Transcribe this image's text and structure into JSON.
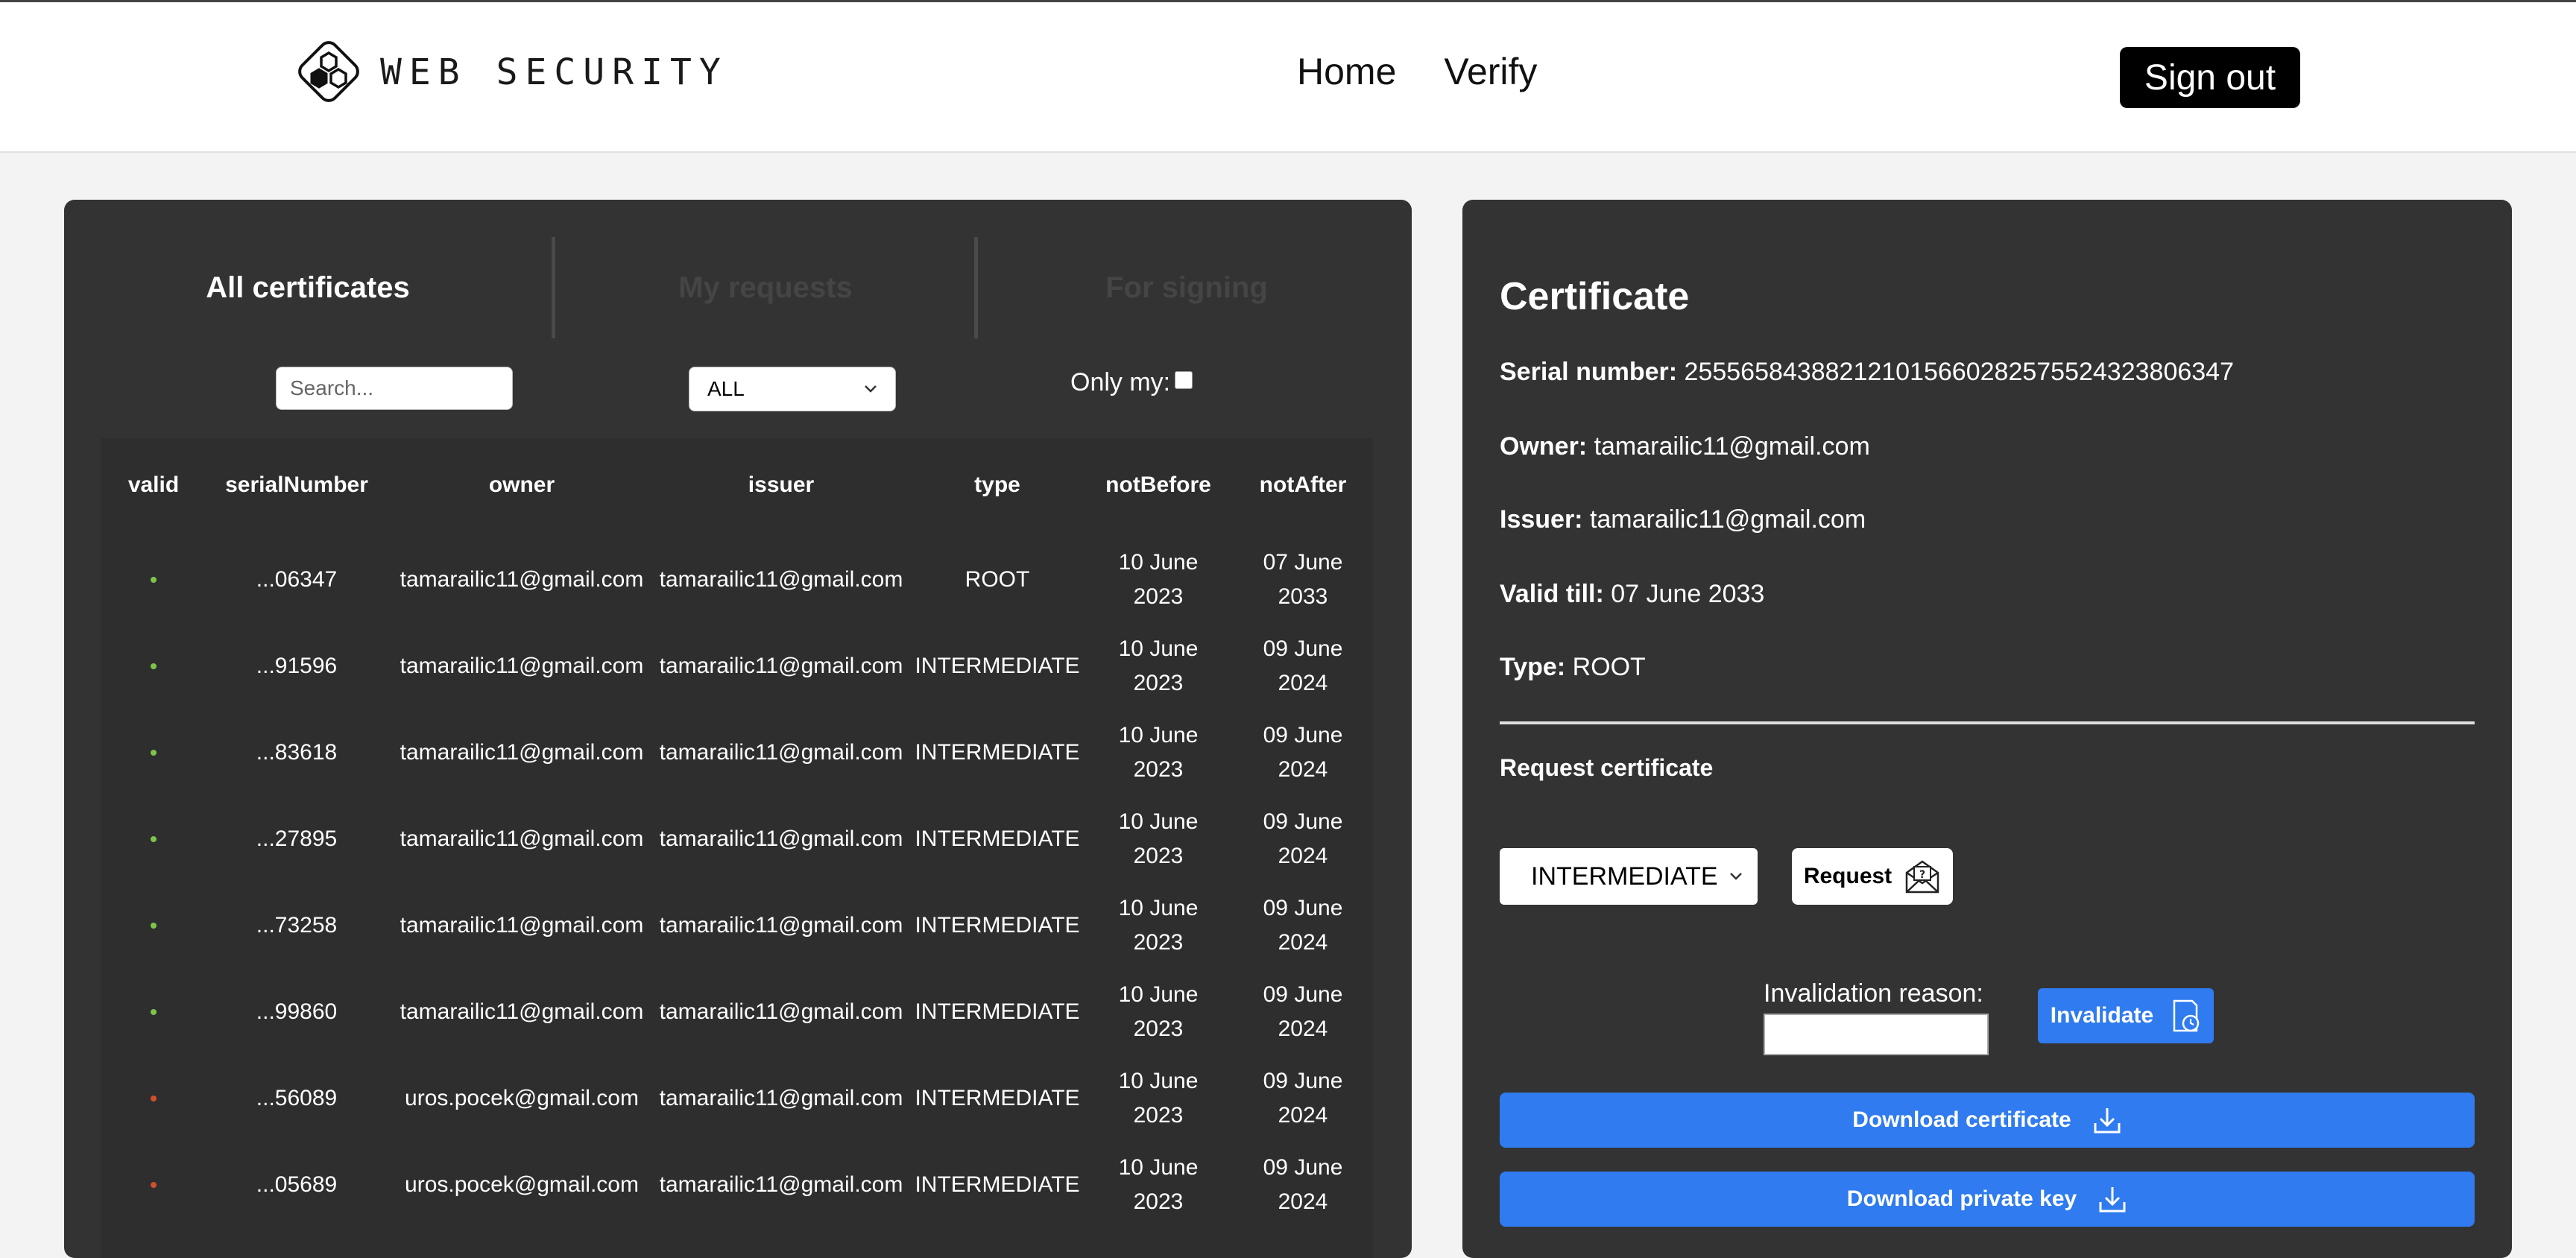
{
  "header": {
    "logo_text": "WEB SECURITY",
    "nav": [
      "Home",
      "Verify"
    ],
    "signout_label": "Sign out"
  },
  "tabs": [
    "All certificates",
    "My requests",
    "For signing"
  ],
  "filters": {
    "search_placeholder": "Search...",
    "type_filter_value": "ALL",
    "only_my_label": "Only my:"
  },
  "table": {
    "columns": [
      "valid",
      "serialNumber",
      "owner",
      "issuer",
      "type",
      "notBefore",
      "notAfter"
    ],
    "rows": [
      {
        "valid": true,
        "serial": "...06347",
        "owner": "tamarailic11@gmail.com",
        "issuer": "tamarailic11@gmail.com",
        "type": "ROOT",
        "notBefore": [
          "10 June",
          "2023"
        ],
        "notAfter": [
          "07 June",
          "2033"
        ]
      },
      {
        "valid": true,
        "serial": "...91596",
        "owner": "tamarailic11@gmail.com",
        "issuer": "tamarailic11@gmail.com",
        "type": "INTERMEDIATE",
        "notBefore": [
          "10 June",
          "2023"
        ],
        "notAfter": [
          "09 June",
          "2024"
        ]
      },
      {
        "valid": true,
        "serial": "...83618",
        "owner": "tamarailic11@gmail.com",
        "issuer": "tamarailic11@gmail.com",
        "type": "INTERMEDIATE",
        "notBefore": [
          "10 June",
          "2023"
        ],
        "notAfter": [
          "09 June",
          "2024"
        ]
      },
      {
        "valid": true,
        "serial": "...27895",
        "owner": "tamarailic11@gmail.com",
        "issuer": "tamarailic11@gmail.com",
        "type": "INTERMEDIATE",
        "notBefore": [
          "10 June",
          "2023"
        ],
        "notAfter": [
          "09 June",
          "2024"
        ]
      },
      {
        "valid": true,
        "serial": "...73258",
        "owner": "tamarailic11@gmail.com",
        "issuer": "tamarailic11@gmail.com",
        "type": "INTERMEDIATE",
        "notBefore": [
          "10 June",
          "2023"
        ],
        "notAfter": [
          "09 June",
          "2024"
        ]
      },
      {
        "valid": true,
        "serial": "...99860",
        "owner": "tamarailic11@gmail.com",
        "issuer": "tamarailic11@gmail.com",
        "type": "INTERMEDIATE",
        "notBefore": [
          "10 June",
          "2023"
        ],
        "notAfter": [
          "09 June",
          "2024"
        ]
      },
      {
        "valid": false,
        "serial": "...56089",
        "owner": "uros.pocek@gmail.com",
        "issuer": "tamarailic11@gmail.com",
        "type": "INTERMEDIATE",
        "notBefore": [
          "10 June",
          "2023"
        ],
        "notAfter": [
          "09 June",
          "2024"
        ]
      },
      {
        "valid": false,
        "serial": "...05689",
        "owner": "uros.pocek@gmail.com",
        "issuer": "tamarailic11@gmail.com",
        "type": "INTERMEDIATE",
        "notBefore": [
          "10 June",
          "2023"
        ],
        "notAfter": [
          "09 June",
          "2024"
        ]
      }
    ]
  },
  "certificate": {
    "title": "Certificate",
    "serial_label": "Serial number:",
    "serial_value": "255565843882121015660282575524323806347",
    "owner_label": "Owner:",
    "owner_value": "tamarailic11@gmail.com",
    "issuer_label": "Issuer:",
    "issuer_value": "tamarailic11@gmail.com",
    "valid_label": "Valid till:",
    "valid_value": "07 June 2033",
    "type_label": "Type:",
    "type_value": "ROOT"
  },
  "request": {
    "title": "Request certificate",
    "type_value": "INTERMEDIATE",
    "button_label": "Request"
  },
  "invalidate": {
    "reason_label": "Invalidation reason:",
    "button_label": "Invalidate"
  },
  "downloads": {
    "certificate_label": "Download certificate",
    "private_key_label": "Download private key"
  },
  "colors": {
    "valid_dot": "#7cc44a",
    "invalid_dot": "#d0502d",
    "accent": "#2f7bef"
  }
}
